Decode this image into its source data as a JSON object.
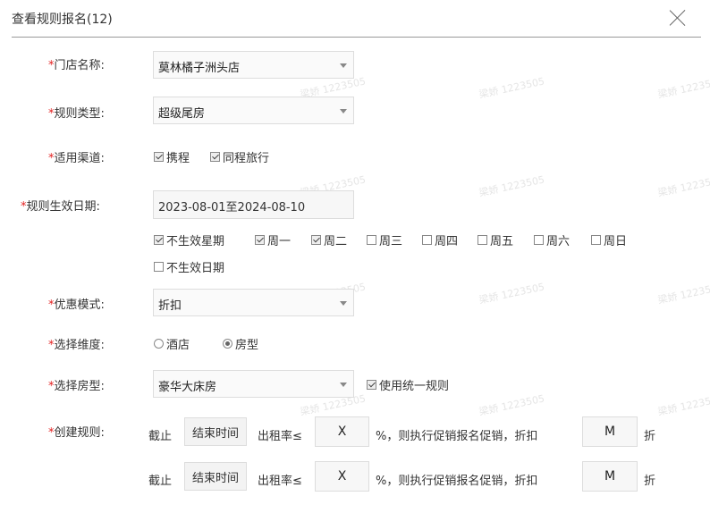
{
  "dialog": {
    "title": "查看规则报名(12)"
  },
  "form": {
    "store": {
      "label": "门店名称:",
      "value": "莫林橘子洲头店"
    },
    "rule_type": {
      "label": "规则类型:",
      "value": "超级尾房"
    },
    "channels": {
      "label": "适用渠道:",
      "options": [
        {
          "label": "携程",
          "checked": true
        },
        {
          "label": "同程旅行",
          "checked": true
        }
      ]
    },
    "effective_date": {
      "label": "规则生效日期:",
      "value": "2023-08-01至2024-08-10"
    },
    "weekdays": [
      {
        "label": "不生效星期",
        "checked": true
      },
      {
        "label": "周一",
        "checked": true
      },
      {
        "label": "周二",
        "checked": true
      },
      {
        "label": "周三",
        "checked": false
      },
      {
        "label": "周四",
        "checked": false
      },
      {
        "label": "周五",
        "checked": false
      },
      {
        "label": "周六",
        "checked": false
      },
      {
        "label": "周日",
        "checked": false
      }
    ],
    "exclude_date": {
      "label": "不生效日期",
      "checked": false
    },
    "discount_mode": {
      "label": "优惠模式:",
      "value": "折扣"
    },
    "dimension": {
      "label": "选择维度:",
      "options": [
        {
          "label": "酒店",
          "checked": false
        },
        {
          "label": "房型",
          "checked": true
        }
      ]
    },
    "room_type": {
      "label": "选择房型:",
      "value": "豪华大床房",
      "unified": {
        "label": "使用统一规则",
        "checked": true
      }
    },
    "create_rule": {
      "label": "创建规则:",
      "rows": [
        {
          "prefix": "截止",
          "time": "结束时间",
          "rate_label": "出租率≤",
          "x": "X",
          "middle": "%，则执行促销报名促销，折扣",
          "m": "M",
          "suffix": "折"
        },
        {
          "prefix": "截止",
          "time": "结束时间",
          "rate_label": "出租率≤",
          "x": "X",
          "middle": "%，则执行促销报名促销，折扣",
          "m": "M",
          "suffix": "折"
        }
      ]
    }
  },
  "watermark": "梁娇 1223505"
}
